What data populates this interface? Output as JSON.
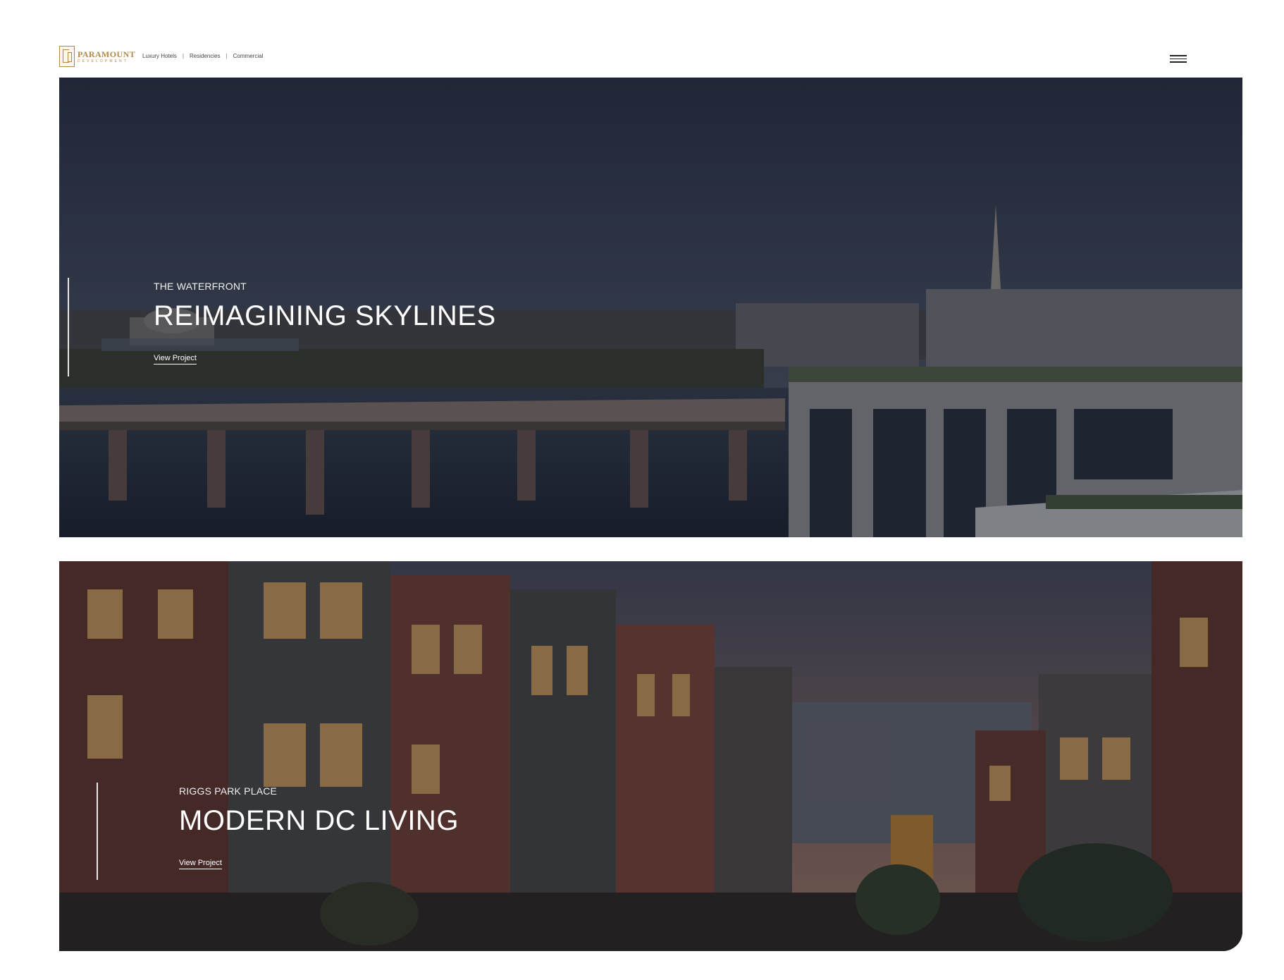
{
  "header": {
    "logo": {
      "name": "PARAMOUNT",
      "sub": "DEVELOPMENT"
    },
    "nav": [
      {
        "label": "Luxury Hotels"
      },
      {
        "label": "Residencies"
      },
      {
        "label": "Commercial"
      }
    ],
    "nav_separator": "|",
    "menu_icon": "hamburger-menu-icon"
  },
  "projects": [
    {
      "eyebrow": "THE WATERFRONT",
      "headline": "REIMAGINING SKYLINES",
      "link": "View Project"
    },
    {
      "eyebrow": "RIGGS PARK PLACE",
      "headline": "MODERN DC LIVING",
      "link": "View Project"
    }
  ],
  "colors": {
    "brand_gold": "#b08a45",
    "overlay": "#0f121c",
    "text": "#ffffff"
  }
}
